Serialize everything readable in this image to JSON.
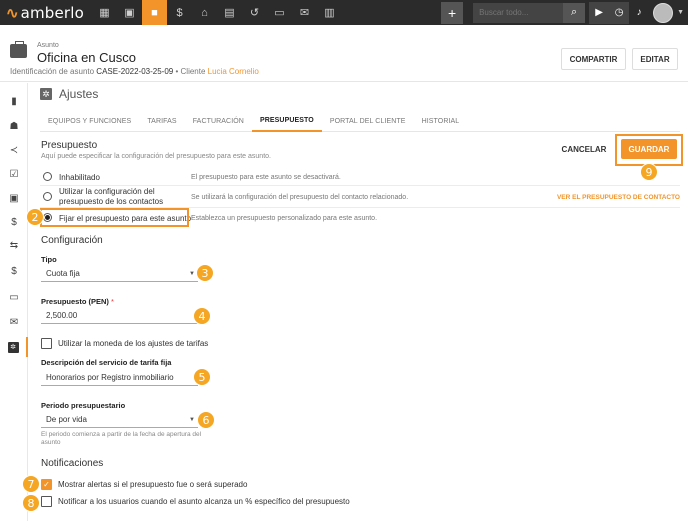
{
  "brand": {
    "logo_text": "amberlo",
    "accent": "#f29429"
  },
  "topbar": {
    "nav_icons": [
      "dashboard-icon",
      "contacts-icon",
      "matters-icon",
      "billing-icon",
      "bank-icon",
      "calendar-icon",
      "timer-history-icon",
      "folder-icon",
      "mail-icon",
      "reports-icon"
    ],
    "search_placeholder": "Buscar todo...",
    "plus_label": "+"
  },
  "header": {
    "subtitle": "Asunto",
    "title": "Oficina en Cusco",
    "meta_prefix": "Identificación de asunto",
    "matter_id": "CASE-2022-03-25-09",
    "separator": "•",
    "client_label": "Cliente",
    "client_name": "Lucia Cornelio",
    "share_label": "COMPARTIR",
    "edit_label": "EDITAR"
  },
  "settings": {
    "title": "Ajustes",
    "tabs": [
      {
        "label": "EQUIPOS Y FUNCIONES",
        "active": false
      },
      {
        "label": "TARIFAS",
        "active": false
      },
      {
        "label": "FACTURACIÓN",
        "active": false
      },
      {
        "label": "PRESUPUESTO",
        "active": true
      },
      {
        "label": "PORTAL DEL CLIENTE",
        "active": false
      },
      {
        "label": "HISTORIAL",
        "active": false
      }
    ]
  },
  "budget": {
    "title": "Presupuesto",
    "subtitle": "Aquí puede especificar la configuración del presupuesto para este asunto.",
    "cancel_label": "CANCELAR",
    "save_label": "GUARDAR",
    "options": [
      {
        "label": "Inhabilitado",
        "desc": "El presupuesto para este asunto se desactivará.",
        "checked": false
      },
      {
        "label_line1": "Utilizar la configuración del",
        "label_line2": "presupuesto de los contactos",
        "desc": "Se utilizará la configuración del presupuesto del contacto relacionado.",
        "link": "VER EL PRESUPUESTO DE CONTACTO",
        "checked": false
      },
      {
        "label": "Fijar el presupuesto para este asunto",
        "desc": "Establezca un presupuesto personalizado para este asunto.",
        "checked": true
      }
    ]
  },
  "config": {
    "title": "Configuración",
    "type_label": "Tipo",
    "type_value": "Cuota fija",
    "amount_label": "Presupuesto (PEN)",
    "required_mark": "*",
    "amount_value": "2,500.00",
    "use_currency_label": "Utilizar la moneda de los ajustes de tarifas",
    "desc_label": "Descripción del servicio de tarifa fija",
    "desc_value": "Honorarios por Registro inmobiliario",
    "period_label": "Periodo presupuestario",
    "period_value": "De por vida",
    "period_help": "El periodo comienza a partir de la fecha de apertura del asunto"
  },
  "notifications": {
    "title": "Notificaciones",
    "alert_label": "Mostrar alertas si el presupuesto fue o será superado",
    "alert_checked": true,
    "notify_label": "Notificar a los usuarios cuando el asunto alcanza un % específico del presupuesto",
    "notify_checked": false
  },
  "badges": [
    "2",
    "3",
    "4",
    "5",
    "6",
    "7",
    "8",
    "9"
  ]
}
